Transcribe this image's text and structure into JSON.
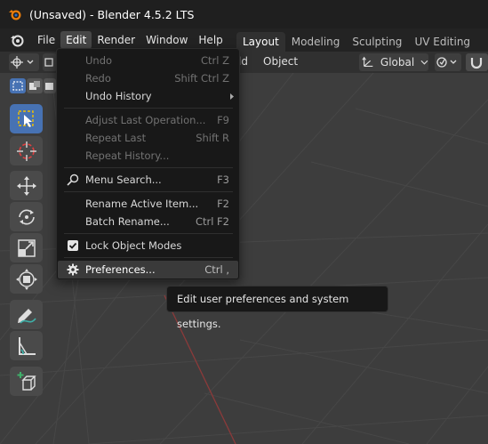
{
  "window": {
    "title": "(Unsaved) - Blender 4.5.2 LTS"
  },
  "menubar": {
    "items": [
      {
        "label": "File"
      },
      {
        "label": "Edit"
      },
      {
        "label": "Render"
      },
      {
        "label": "Window"
      },
      {
        "label": "Help"
      }
    ]
  },
  "workspaces": {
    "tabs": [
      {
        "label": "Layout"
      },
      {
        "label": "Modeling"
      },
      {
        "label": "Sculpting"
      },
      {
        "label": "UV Editing"
      }
    ],
    "active": "Layout"
  },
  "header": {
    "add_label": "ld",
    "object_label": "Object",
    "orientation_label": "Global"
  },
  "edit_menu": {
    "items": [
      {
        "label": "Undo",
        "shortcut": "Ctrl Z",
        "enabled": false
      },
      {
        "label": "Redo",
        "shortcut": "Shift Ctrl Z",
        "enabled": false
      },
      {
        "label": "Undo History",
        "shortcut": "",
        "enabled": true,
        "submenu": true
      },
      {
        "label": "Adjust Last Operation...",
        "shortcut": "F9",
        "enabled": false
      },
      {
        "label": "Repeat Last",
        "shortcut": "Shift R",
        "enabled": false
      },
      {
        "label": "Repeat History...",
        "shortcut": "",
        "enabled": false
      },
      {
        "label": "Menu Search...",
        "shortcut": "F3",
        "enabled": true,
        "icon": "search-icon"
      },
      {
        "label": "Rename Active Item...",
        "shortcut": "F2",
        "enabled": true
      },
      {
        "label": "Batch Rename...",
        "shortcut": "Ctrl F2",
        "enabled": true
      },
      {
        "label": "Lock Object Modes",
        "shortcut": "",
        "enabled": true,
        "checked": true,
        "icon": "checkbox-icon"
      },
      {
        "label": "Preferences...",
        "shortcut": "Ctrl ,",
        "enabled": true,
        "highlighted": true,
        "icon": "gear-icon"
      }
    ]
  },
  "tooltip": {
    "text": "Edit user preferences and system settings."
  },
  "colors": {
    "accent": "#4772b3",
    "titlebar_bg": "#1f1f1f",
    "menu_bg": "#181818",
    "viewport_bg": "#3d3d3d",
    "x_axis": "#8b3a3a"
  },
  "toolbar": {
    "tools": [
      {
        "icon": "select-box-icon",
        "active": true
      },
      {
        "icon": "cursor-icon",
        "active": false
      },
      {
        "icon": "move-icon",
        "active": false
      },
      {
        "icon": "rotate-icon",
        "active": false
      },
      {
        "icon": "scale-icon",
        "active": false
      },
      {
        "icon": "transform-icon",
        "active": false
      },
      {
        "icon": "annotate-icon",
        "active": false
      },
      {
        "icon": "measure-icon",
        "active": false
      },
      {
        "icon": "add-cube-icon",
        "active": false
      }
    ]
  }
}
